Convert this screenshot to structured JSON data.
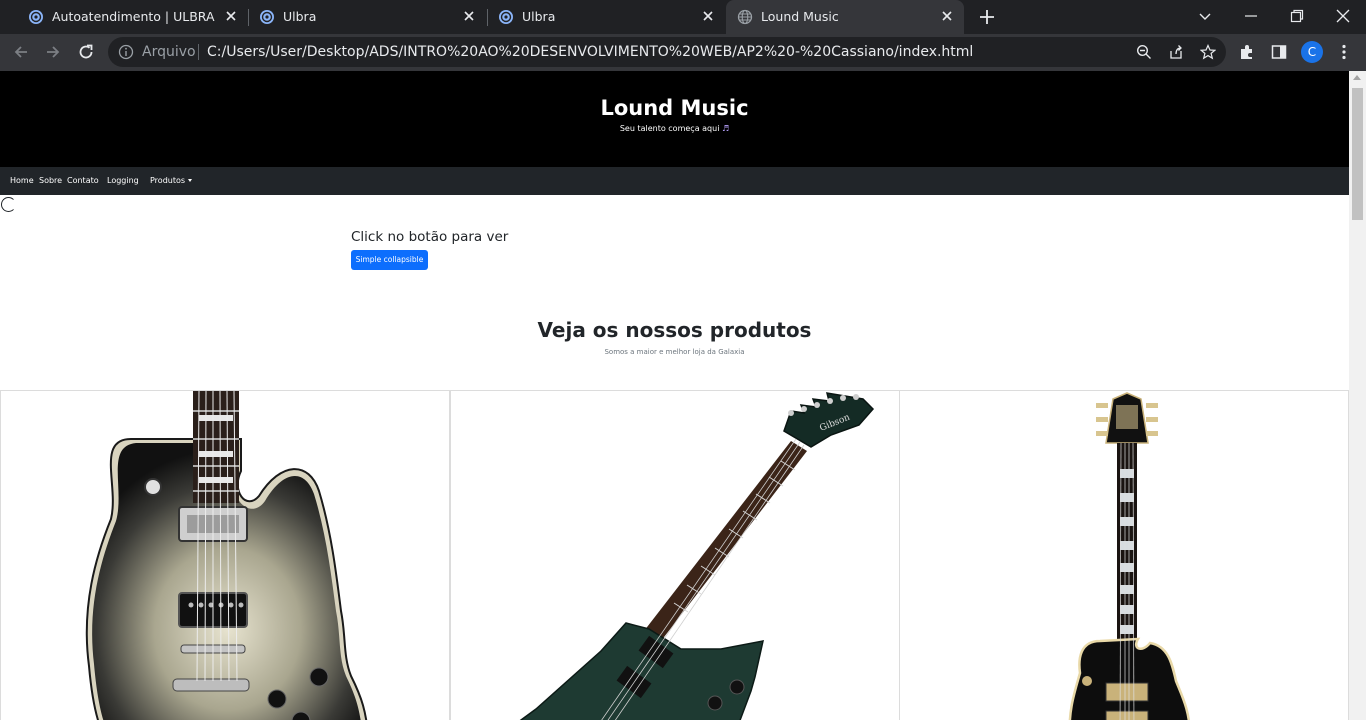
{
  "browser": {
    "tabs": [
      {
        "title": "Autoatendimento | ULBRA",
        "active": false,
        "icon": "ulbra-favicon-icon"
      },
      {
        "title": "Ulbra",
        "active": false,
        "icon": "ulbra-favicon-icon"
      },
      {
        "title": "Ulbra",
        "active": false,
        "icon": "ulbra-favicon-icon"
      },
      {
        "title": "Lound Music",
        "active": true,
        "icon": "globe-icon"
      }
    ],
    "address": {
      "scheme_label": "Arquivo",
      "url": "C:/Users/User/Desktop/ADS/INTRO%20AO%20DESENVOLVIMENTO%20WEB/AP2%20-%20Cassiano/index.html"
    },
    "profile_initial": "C",
    "colors": {
      "tabstrip": "#202124",
      "toolbar": "#35363a",
      "accent": "#1a73e8"
    }
  },
  "site": {
    "title": "Lound Music",
    "tagline": "Seu talento começa aqui",
    "tagline_icon": "♬",
    "nav": {
      "home": "Home",
      "about": "Sobre",
      "contact": "Contato",
      "login": "Logging",
      "products": "Produtos"
    },
    "collapse": {
      "heading": "Click no botão para ver",
      "button": "Simple collapsible"
    },
    "products_section": {
      "title": "Veja os nossos produtos",
      "subtitle": "Somos a maior e melhor loja da Galaxia"
    },
    "products": [
      {
        "image": "silverburst-les-paul-guitar"
      },
      {
        "image": "black-explorer-style-guitar"
      },
      {
        "image": "black-les-paul-custom-guitar"
      }
    ],
    "colors": {
      "header": "#000000",
      "navbar": "#212529",
      "primary_button": "#0d6efd"
    }
  }
}
